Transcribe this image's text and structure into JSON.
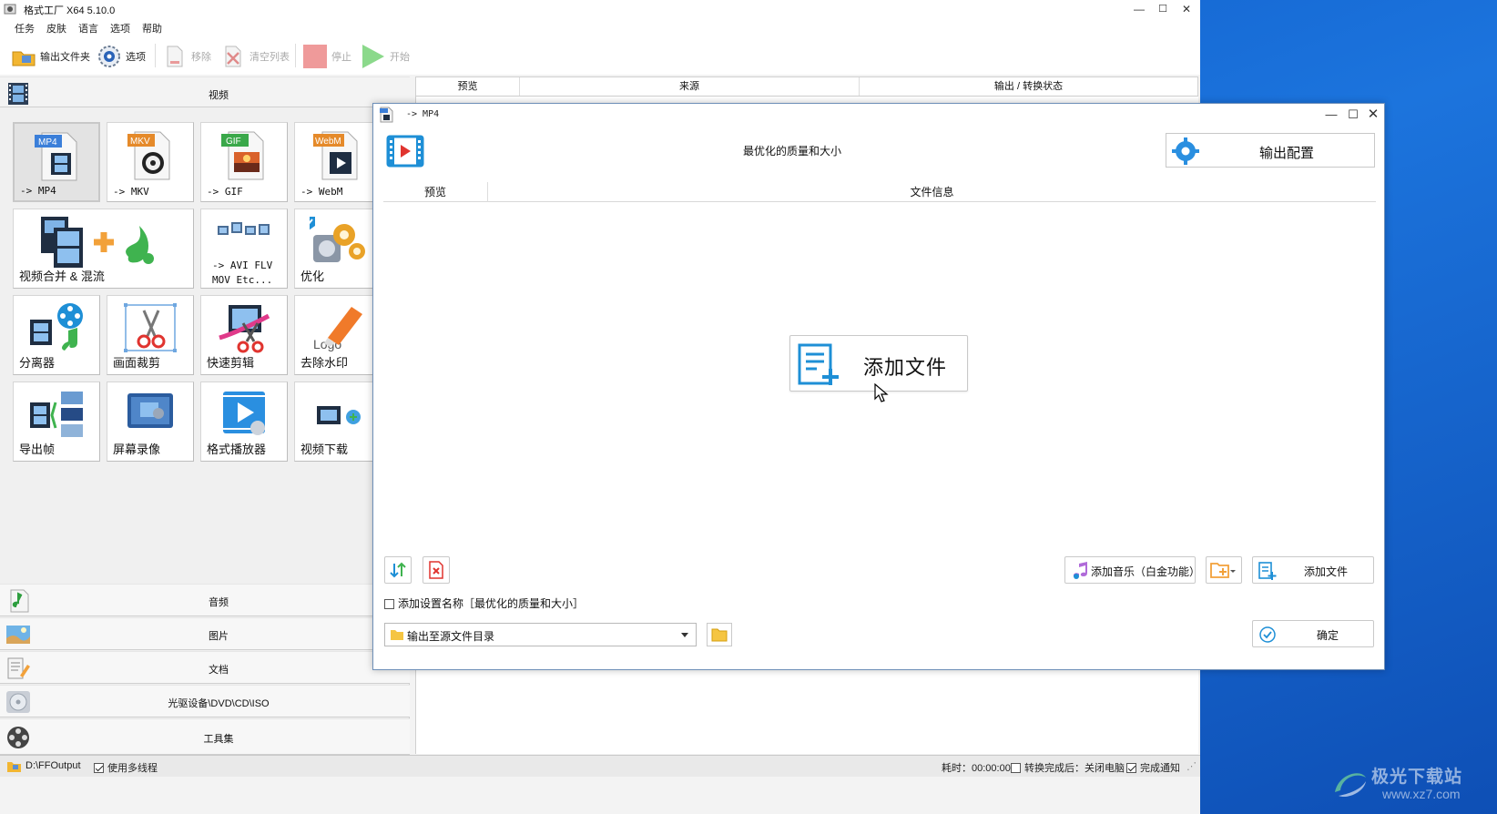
{
  "main_window": {
    "title": "格式工厂 X64 5.10.0",
    "controls": {
      "minimize": "—",
      "maximize": "☐",
      "close": "✕"
    }
  },
  "menu": [
    "任务",
    "皮肤",
    "语言",
    "选项",
    "帮助"
  ],
  "toolbar": {
    "output_folder": "输出文件夹",
    "options": "选项",
    "remove": "移除",
    "clear_list": "清空列表",
    "stop": "停止",
    "start": "开始"
  },
  "left_panel": {
    "video_header": "视频",
    "tiles": [
      {
        "label": "-> MP4",
        "icon": "mp4-file-icon"
      },
      {
        "label": "-> MKV",
        "icon": "mkv-file-icon"
      },
      {
        "label": "-> GIF",
        "icon": "gif-file-icon"
      },
      {
        "label": "-> WebM",
        "icon": "webm-file-icon"
      },
      {
        "label": "视频合并 & 混流",
        "icon": "video-merge-icon"
      },
      {
        "label": "-> AVI FLV",
        "label2": "MOV Etc...",
        "icon": "multi-format-icon"
      },
      {
        "label": "优化",
        "icon": "optimize-gears-icon"
      },
      {
        "label": "分离器",
        "icon": "splitter-icon"
      },
      {
        "label": "画面裁剪",
        "icon": "crop-scissors-icon"
      },
      {
        "label": "快速剪辑",
        "icon": "quick-clip-icon"
      },
      {
        "label": "去除水印",
        "icon": "remove-logo-eraser-icon"
      },
      {
        "label": "导出帧",
        "icon": "export-frames-icon"
      },
      {
        "label": "屏幕录像",
        "icon": "screen-record-icon"
      },
      {
        "label": "格式播放器",
        "icon": "player-icon"
      },
      {
        "label": "视频下载",
        "icon": "video-download-icon"
      }
    ],
    "categories": [
      "音频",
      "图片",
      "文档",
      "光驱设备\\DVD\\CD\\ISO",
      "工具集"
    ]
  },
  "list_header": [
    "预览",
    "来源",
    "输出 / 转换状态"
  ],
  "statusbar": {
    "output_path": "D:\\FFOutput",
    "multithread": "使用多线程",
    "elapsed": "耗时：00:00:00",
    "after_convert": "转换完成后：关闭电脑",
    "notify": "完成通知"
  },
  "dialog": {
    "title": "-> MP4",
    "controls": {
      "minimize": "—",
      "maximize": "☐",
      "close": "✕"
    },
    "profile": "最优化的质量和大小",
    "output_config": "输出配置",
    "table_header": [
      "预览",
      "文件信息"
    ],
    "add_file_big": "添加文件",
    "add_music": "添加音乐（白金功能）",
    "add_file": "添加文件",
    "add_setting_name": "添加设置名称［最优化的质量和大小］",
    "output_dir": "输出至源文件目录",
    "ok": "确定"
  },
  "watermark": {
    "title": "极光下载站",
    "url": "www.xz7.com"
  },
  "colors": {
    "accent_blue": "#1e8fd6",
    "desktop_blue": "#1c6fd8",
    "green": "#37b34a"
  }
}
